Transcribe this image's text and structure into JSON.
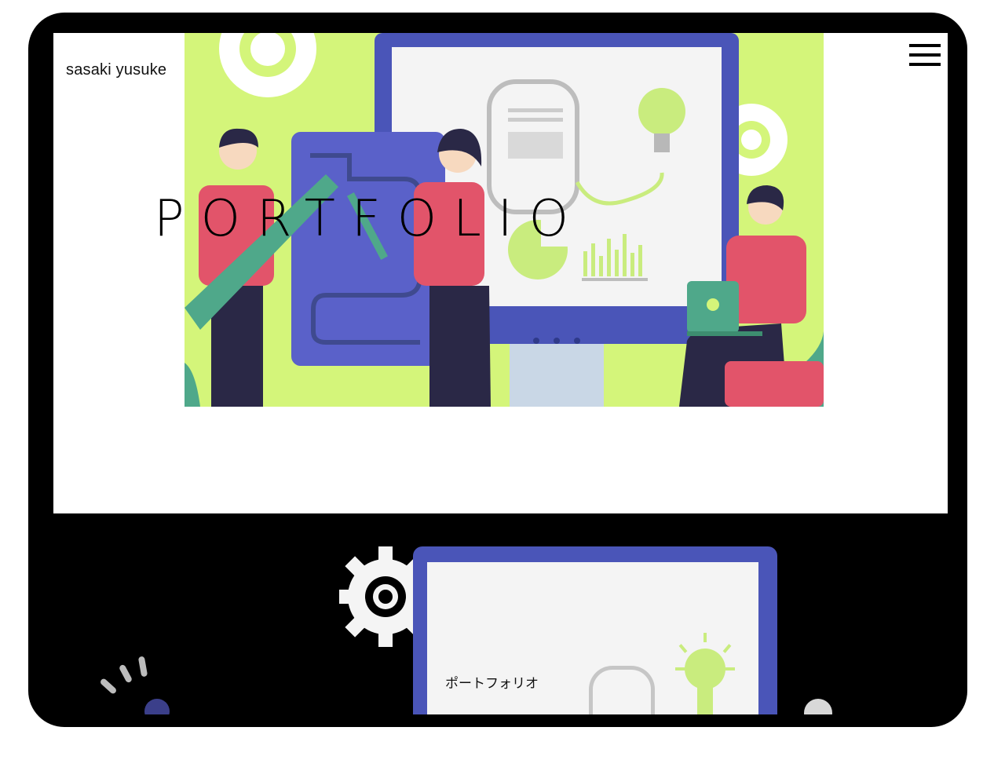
{
  "header": {
    "site_name": "sasaki yusuke",
    "menu_icon": "hamburger-icon"
  },
  "hero": {
    "title": "PORTFOLIO",
    "illustration": "team-presentation-illustration"
  },
  "works": {
    "thumbnail_label": "ポートフォリオ"
  },
  "colors": {
    "lime": "#d4f57a",
    "indigo": "#4a55b8",
    "blue": "#5a61c9",
    "pink": "#e2546a",
    "navy": "#2a2846",
    "green": "#4fa88a",
    "bulb": "#c9ec7e"
  }
}
